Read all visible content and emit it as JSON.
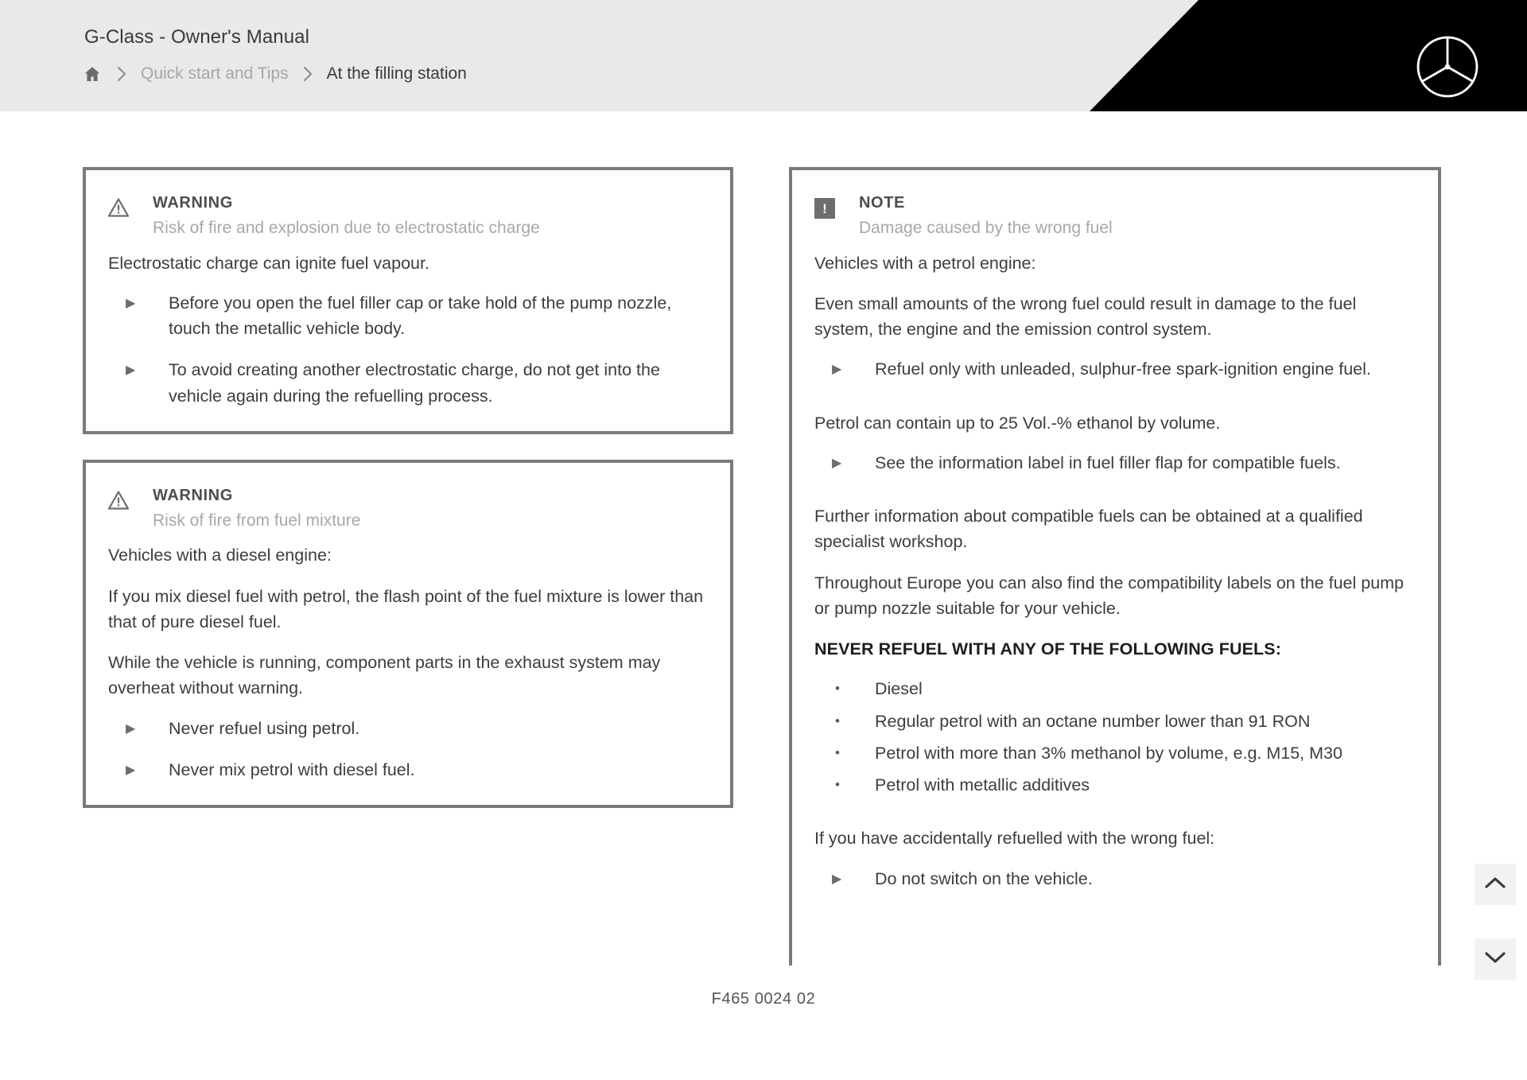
{
  "header": {
    "title": "G-Class - Owner's Manual",
    "home_icon": "home-icon",
    "breadcrumb": [
      {
        "label": "Quick start and Tips",
        "state": "muted"
      },
      {
        "label": "At the filling station",
        "state": "current"
      }
    ],
    "separator": "›",
    "brand_logo": "mercedes-star-logo"
  },
  "left_column": {
    "warning_1": {
      "icon": "warning-triangle-icon",
      "label": "WARNING",
      "subtitle": "Risk of fire and explosion due to electrostatic charge",
      "paragraph": "Electrostatic charge can ignite fuel vapour.",
      "bullets": [
        "Before you open the fuel filler cap or take hold of the pump nozzle, touch the metallic vehicle body.",
        "To avoid creating another electrostatic charge, do not get into the vehicle again during the refuelling process."
      ]
    },
    "warning_2": {
      "icon": "warning-triangle-icon",
      "label": "WARNING",
      "subtitle": "Risk of fire from fuel mixture",
      "paragraph_1": "Vehicles with a diesel engine:",
      "paragraph_2": "If you mix diesel fuel with petrol, the flash point of the fuel mixture is lower than that of pure diesel fuel.",
      "paragraph_3": "While the vehicle is running, component parts in the exhaust system may overheat without warning.",
      "bullets": [
        "Never refuel using petrol.",
        "Never mix petrol with diesel fuel."
      ]
    }
  },
  "right_column": {
    "note": {
      "icon": "note-exclamation-icon",
      "icon_glyph": "!",
      "label": "NOTE",
      "subtitle": "Damage caused by the wrong fuel",
      "paragraph_1": "Vehicles with a petrol engine:",
      "paragraph_2": "Even small amounts of the wrong fuel could result in damage to the fuel system, the engine and the emission control system.",
      "bullets_1": [
        "Refuel only with unleaded, sulphur-free spark-ignition engine fuel."
      ],
      "paragraph_3": "Petrol can contain up to 25 Vol.-% ethanol by volume.",
      "bullets_2": [
        "See the information label in fuel filler flap for compatible fuels."
      ],
      "paragraph_4": "Further information about compatible fuels can be obtained at a qualified specialist workshop.",
      "paragraph_5": "Throughout Europe you can also find the compatibility labels on the fuel pump or pump nozzle suitable for your vehicle.",
      "heading_never_refuel": "NEVER REFUEL WITH ANY OF THE FOLLOWING FUELS:",
      "fuel_list": [
        "Diesel",
        "Regular petrol with an octane number lower than 91 RON",
        "Petrol with more than 3% methanol by volume, e.g. M15, M30",
        "Petrol with metallic additives"
      ],
      "paragraph_6": "If you have accidentally refuelled with the wrong fuel:",
      "bullets_3": [
        "Do not switch on the vehicle."
      ]
    }
  },
  "footer": {
    "code": "F465 0024 02"
  },
  "side_buttons": [
    {
      "name": "scroll-up-button",
      "icon": "chevron-up-icon"
    },
    {
      "name": "scroll-down-button",
      "icon": "chevron-down-icon"
    }
  ],
  "markers": {
    "arrow": "▶",
    "dot": "•"
  },
  "colors": {
    "header_bg": "#e9e9e9",
    "header_accent": "#000000",
    "box_border": "#7a7a7a",
    "body_text": "#3d3d3d",
    "muted_text": "#a8a8a8"
  }
}
